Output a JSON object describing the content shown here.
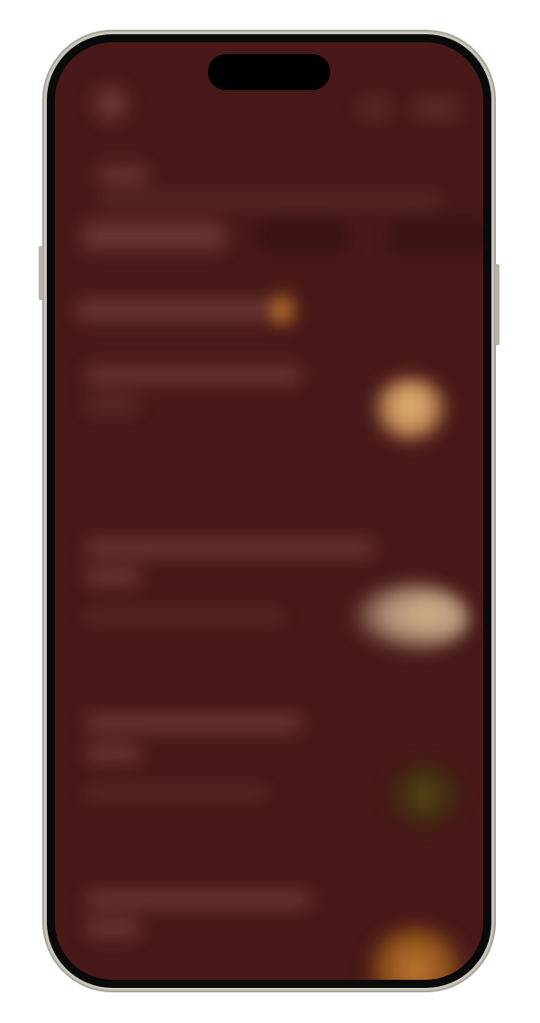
{
  "screen": {
    "background_color": "#481918",
    "state": "blurred"
  },
  "menu_items": [
    {
      "thumbnail_colors": [
        "#d6aa72",
        "#a46b3c"
      ]
    },
    {
      "thumbnail_colors": [
        "#d9b98e",
        "#9a8172"
      ]
    },
    {
      "thumbnail_colors": [
        "#4e3a14",
        "#6b5a20"
      ]
    },
    {
      "thumbnail_colors": [
        "#b9742c",
        "#7b4517"
      ]
    }
  ]
}
